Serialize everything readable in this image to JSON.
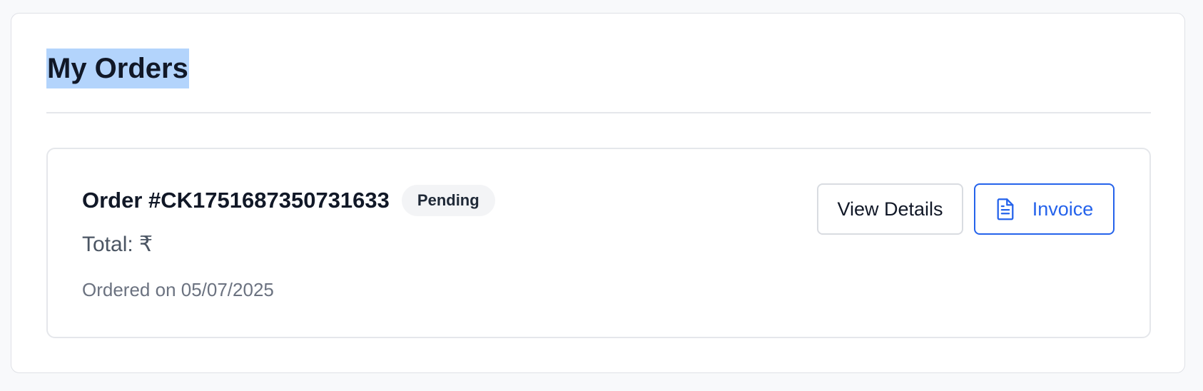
{
  "page": {
    "title": "My Orders"
  },
  "orders": [
    {
      "id_label": "Order #CK1751687350731633",
      "status": "Pending",
      "total_label": "Total: ₹",
      "date_label": "Ordered on 05/07/2025",
      "actions": {
        "details_label": "View Details",
        "invoice_label": "Invoice",
        "invoice_icon": "document-icon"
      }
    }
  ],
  "colors": {
    "accent": "#2563eb",
    "title_highlight": "#b3d4fc",
    "badge_bg": "#f3f4f6"
  }
}
